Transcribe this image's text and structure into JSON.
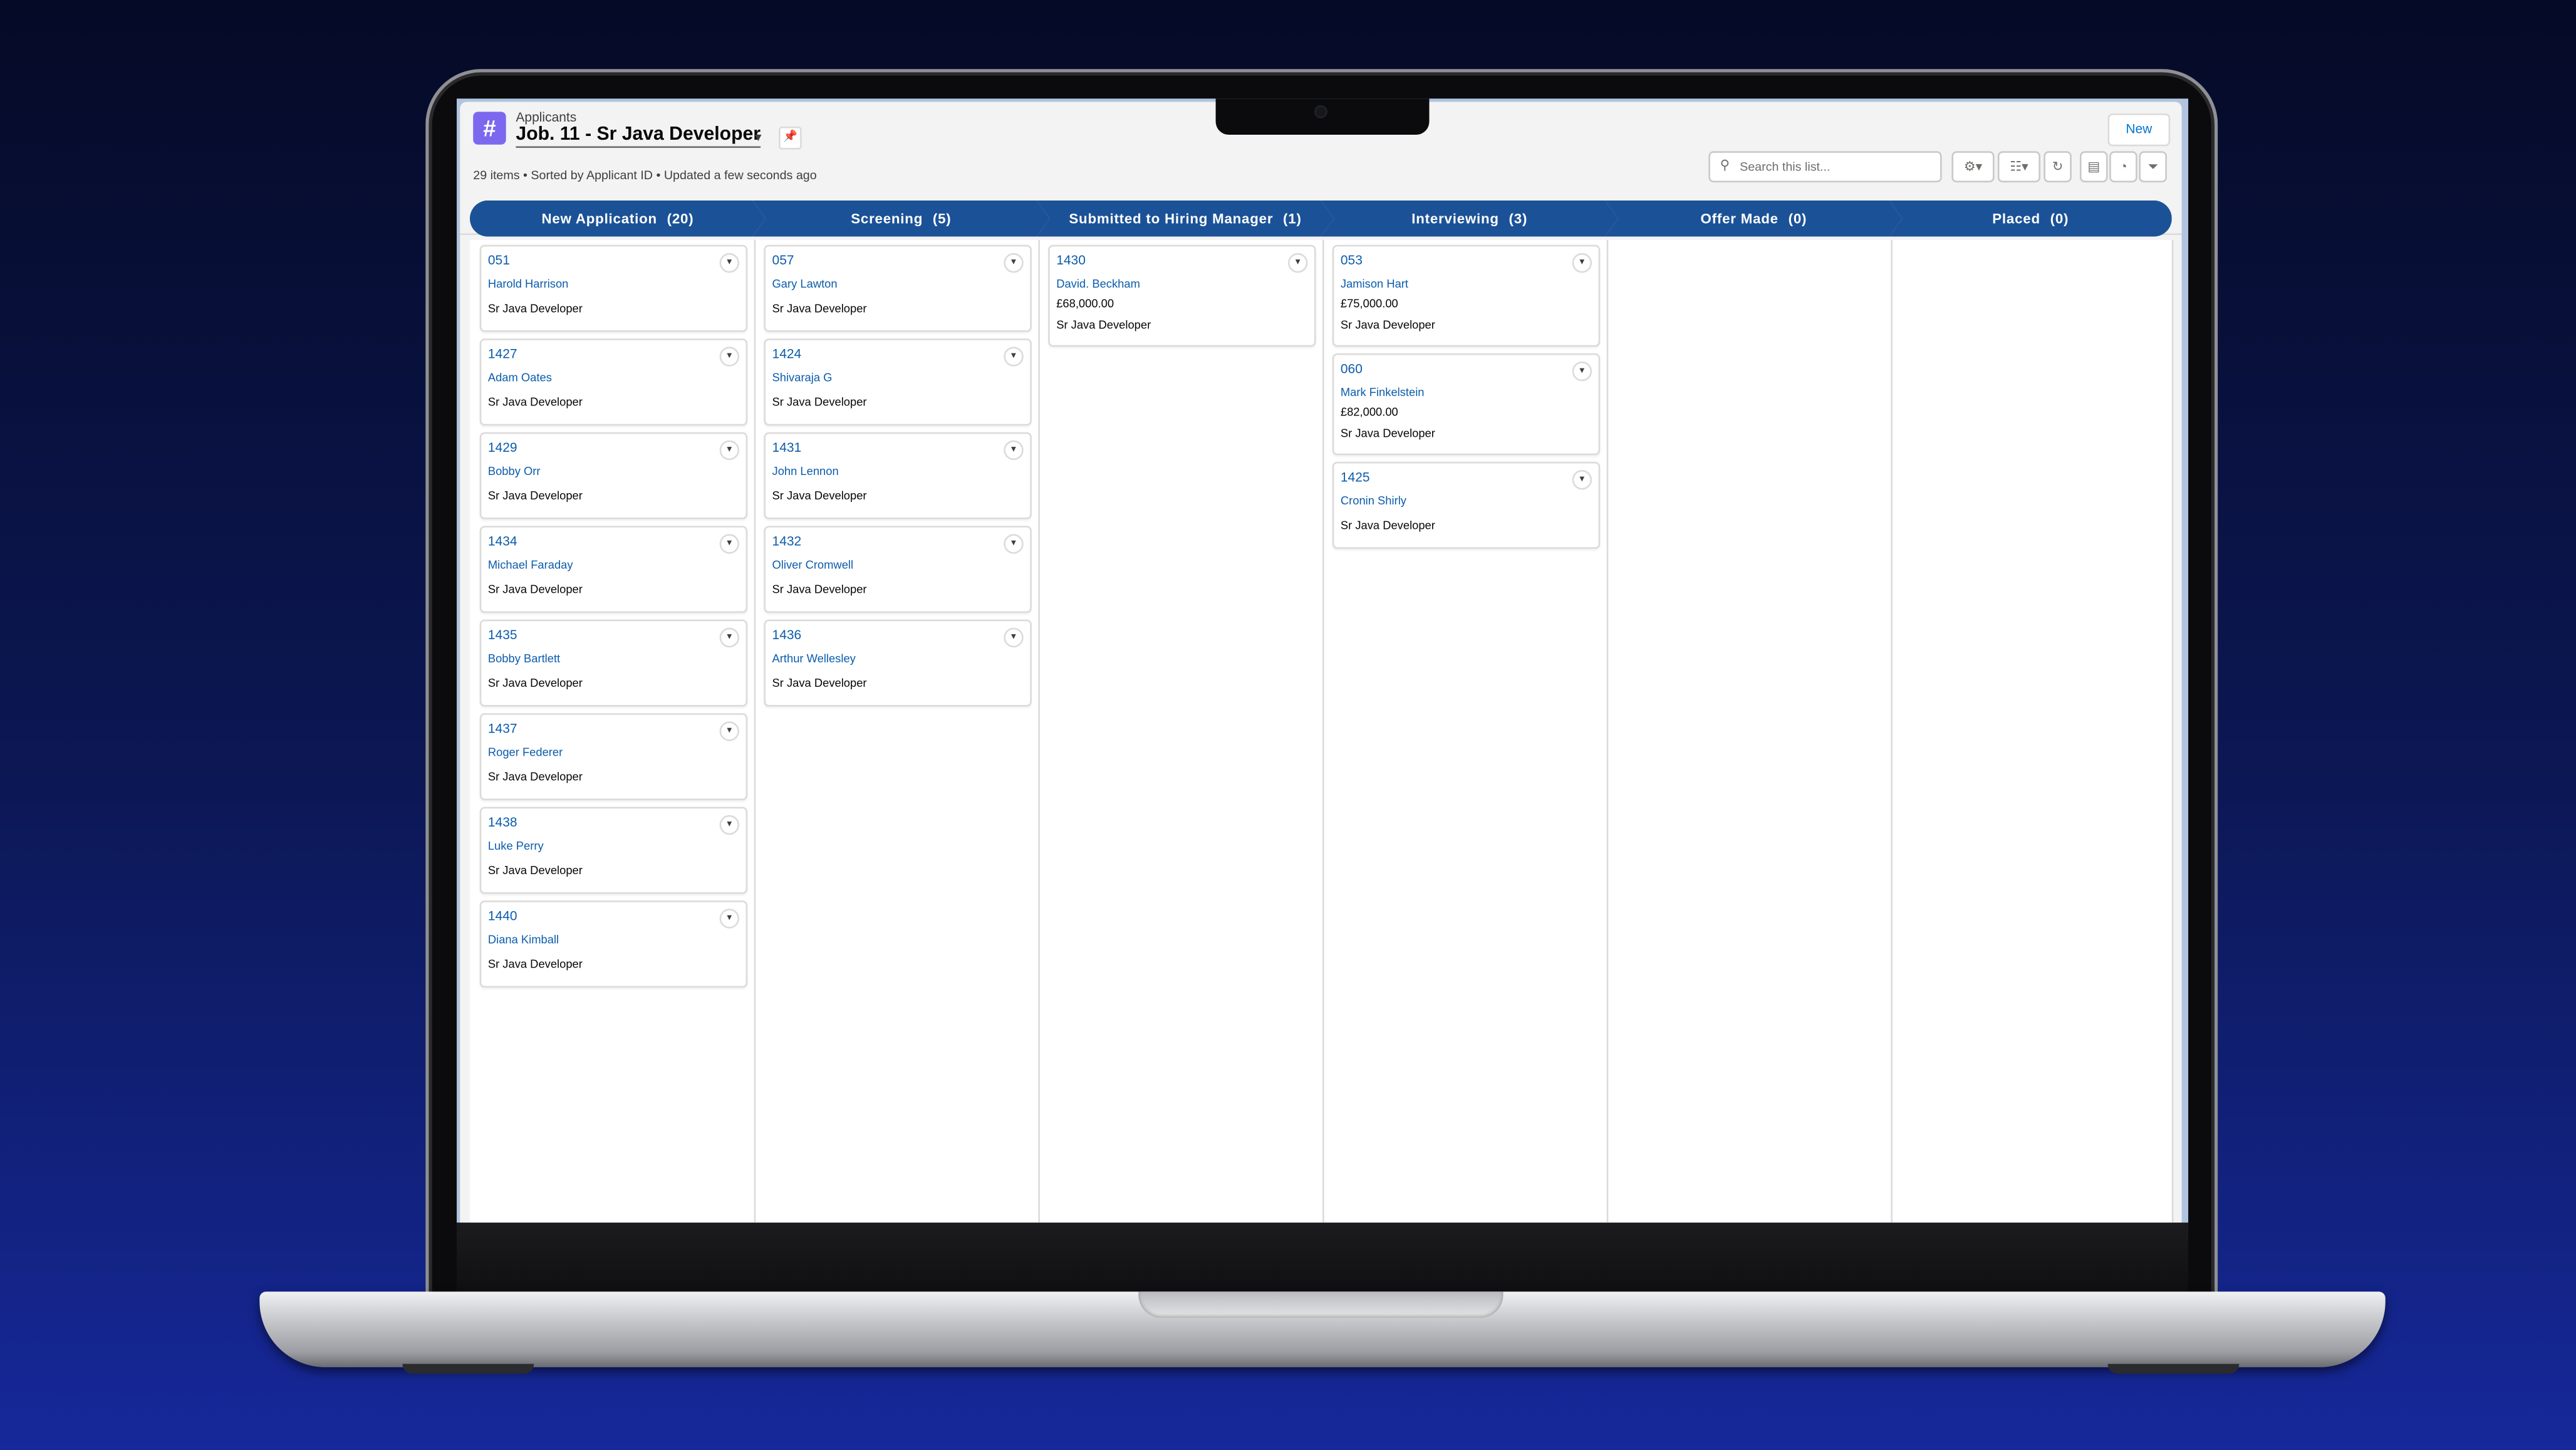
{
  "header": {
    "object_label": "Applicants",
    "object_icon": "#",
    "list_title": "Job. 11 - Sr Java Developer",
    "title_menu_icon": "▾",
    "pin_icon": "📌",
    "meta": "29 items • Sorted by Applicant ID • Updated a few seconds ago",
    "new_button": "New",
    "search_placeholder": "Search this list...",
    "search_icon": "⚲",
    "tools": {
      "settings_icon": "⚙▾",
      "display_as_icon": "☷▾",
      "refresh_icon": "↻",
      "edit_list_icon": "▤",
      "charts_icon": "◔",
      "filter_icon": "⏷"
    }
  },
  "stages": [
    {
      "label": "New Application",
      "count": "(20)"
    },
    {
      "label": "Screening",
      "count": "(5)"
    },
    {
      "label": "Submitted to Hiring Manager",
      "count": "(1)"
    },
    {
      "label": "Interviewing",
      "count": "(3)"
    },
    {
      "label": "Offer Made",
      "count": "(0)"
    },
    {
      "label": "Placed",
      "count": "(0)"
    }
  ],
  "columns": [
    {
      "cards": [
        {
          "id": "051",
          "name": "Harold Harrison",
          "role": "Sr Java Developer"
        },
        {
          "id": "1427",
          "name": "Adam Oates",
          "role": "Sr Java Developer"
        },
        {
          "id": "1429",
          "name": "Bobby Orr",
          "role": "Sr Java Developer"
        },
        {
          "id": "1434",
          "name": "Michael Faraday",
          "role": "Sr Java Developer"
        },
        {
          "id": "1435",
          "name": "Bobby Bartlett",
          "role": "Sr Java Developer"
        },
        {
          "id": "1437",
          "name": "Roger Federer",
          "role": "Sr Java Developer"
        },
        {
          "id": "1438",
          "name": "Luke Perry",
          "role": "Sr Java Developer"
        },
        {
          "id": "1440",
          "name": "Diana Kimball",
          "role": "Sr Java Developer"
        }
      ]
    },
    {
      "cards": [
        {
          "id": "057",
          "name": "Gary Lawton",
          "role": "Sr Java Developer"
        },
        {
          "id": "1424",
          "name": "Shivaraja G",
          "role": "Sr Java Developer"
        },
        {
          "id": "1431",
          "name": "John Lennon",
          "role": "Sr Java Developer"
        },
        {
          "id": "1432",
          "name": "Oliver Cromwell",
          "role": "Sr Java Developer"
        },
        {
          "id": "1436",
          "name": "Arthur Wellesley",
          "role": "Sr Java Developer"
        }
      ]
    },
    {
      "cards": [
        {
          "id": "1430",
          "name": "David. Beckham",
          "amount": "£68,000.00",
          "role": "Sr Java Developer"
        }
      ]
    },
    {
      "cards": [
        {
          "id": "053",
          "name": "Jamison Hart",
          "amount": "£75,000.00",
          "role": "Sr Java Developer"
        },
        {
          "id": "060",
          "name": "Mark Finkelstein",
          "amount": "£82,000.00",
          "role": "Sr Java Developer"
        },
        {
          "id": "1425",
          "name": "Cronin Shirly",
          "role": "Sr Java Developer"
        }
      ]
    },
    {
      "cards": []
    },
    {
      "cards": []
    }
  ],
  "card_menu_icon": "▾",
  "colors": {
    "accent": "#1b5297",
    "link": "#0b5cab",
    "background": "#0c1856"
  }
}
